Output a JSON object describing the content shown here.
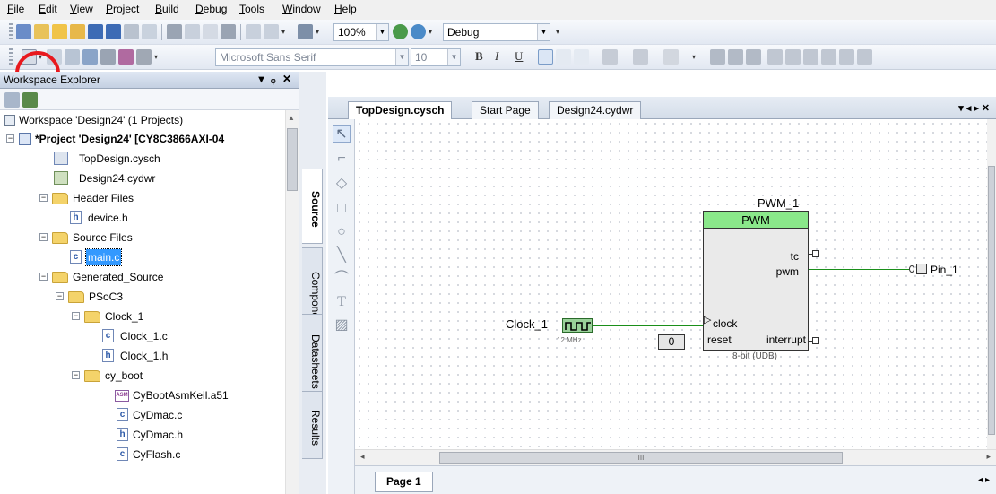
{
  "menubar": {
    "items": [
      {
        "label": "File",
        "key": "F",
        "rest": "ile"
      },
      {
        "label": "Edit",
        "key": "E",
        "rest": "dit"
      },
      {
        "label": "View",
        "key": "V",
        "rest": "iew"
      },
      {
        "label": "Project",
        "key": "P",
        "rest": "roject"
      },
      {
        "label": "Build",
        "key": "B",
        "rest": "uild"
      },
      {
        "label": "Debug",
        "key": "D",
        "rest": "ebug"
      },
      {
        "label": "Tools",
        "key": "T",
        "rest": "ools"
      },
      {
        "label": "Window",
        "key": "W",
        "rest": "indow"
      },
      {
        "label": "Help",
        "key": "H",
        "rest": "elp"
      }
    ]
  },
  "toolbar1": {
    "zoom": "100%",
    "config": "Debug"
  },
  "toolbar2": {
    "font": "Microsoft Sans Serif",
    "size": "10",
    "bold": "B",
    "italic": "I",
    "underline": "U"
  },
  "workspace": {
    "title": "Workspace Explorer",
    "controls": "▾ ᵩ ✕",
    "tree": {
      "workspace": "Workspace 'Design24' (1 Projects)",
      "project": "*Project 'Design24' [CY8C3866AXI-04",
      "topdesign": "TopDesign.cysch",
      "cydwr": "Design24.cydwr",
      "header_files": "Header Files",
      "device_h": "device.h",
      "source_files": "Source Files",
      "main_c": "main.c",
      "generated_source": "Generated_Source",
      "psoc3": "PSoC3",
      "clock_1": "Clock_1",
      "clock_1_c": "Clock_1.c",
      "clock_1_h": "Clock_1.h",
      "cy_boot": "cy_boot",
      "cybootasm": "CyBootAsmKeil.a51",
      "cydmac_c": "CyDmac.c",
      "cydmac_h": "CyDmac.h",
      "cyflash_c": "CyFlash.c"
    }
  },
  "side_tabs": {
    "source": "Source",
    "components": "Components",
    "datasheets": "Datasheets",
    "results": "Results"
  },
  "doc_tabs": {
    "tab1": "TopDesign.cysch",
    "tab2": "Start Page",
    "tab3": "Design24.cydwr"
  },
  "schematic": {
    "pwm_instance": "PWM_1",
    "pwm_header": "PWM",
    "pin_tc": "tc",
    "pin_pwm": "pwm",
    "pin_clock": "clock",
    "pin_reset": "reset",
    "pin_interrupt": "interrupt",
    "pwm_footer": "8-bit (UDB)",
    "clock_label": "Clock_1",
    "clock_freq": "12 MHz",
    "reset_value": "0",
    "pin_label": "Pin_1"
  },
  "page_tab": "Page 1",
  "scroll_mark": "III",
  "colors": {
    "wire": "#1a8f1a",
    "pwm_header": "#8ae88a",
    "highlight": "#3399ff",
    "annotation": "#e8191e"
  }
}
